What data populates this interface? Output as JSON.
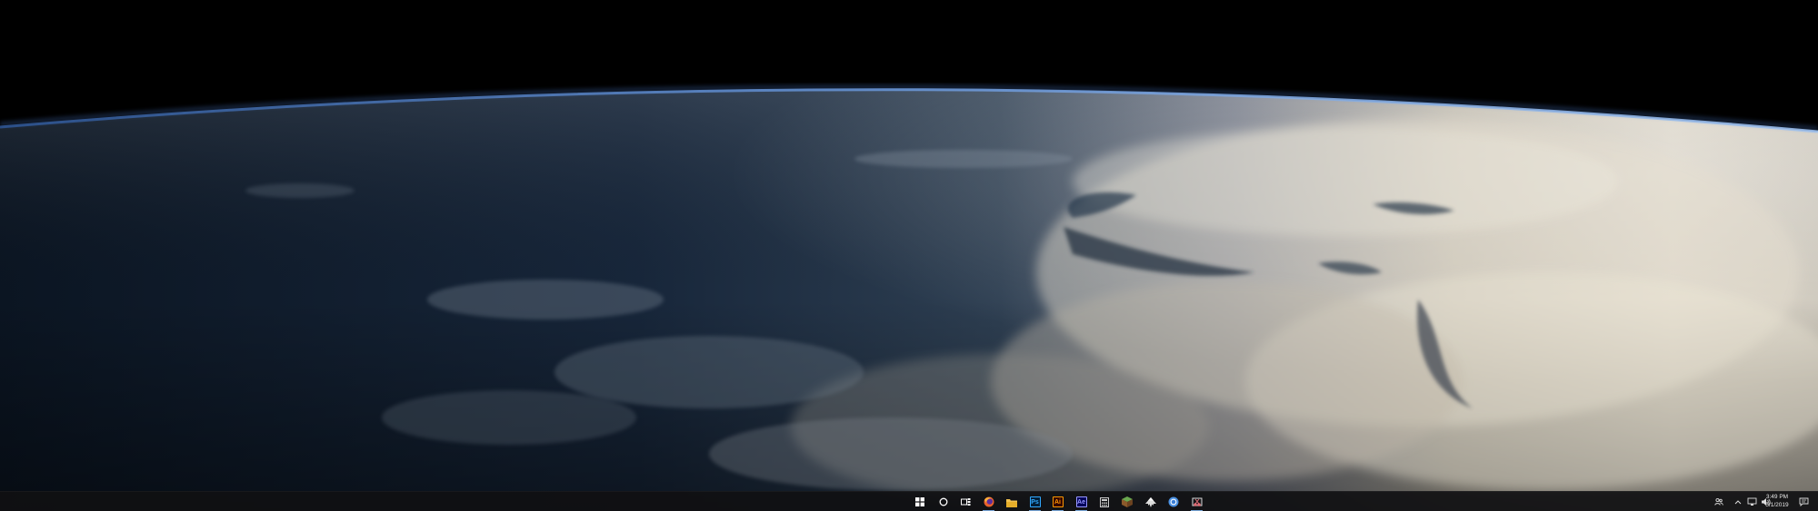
{
  "wallpaper": {
    "description_icon": "earth-from-orbit-wallpaper"
  },
  "taskbar": {
    "start_icon": "windows-logo-icon",
    "search_icon": "cortana-circle-icon",
    "taskview_icon": "task-view-icon",
    "apps": [
      {
        "name": "firefox",
        "icon": "firefox-icon",
        "color": "#e8612c"
      },
      {
        "name": "file-explorer",
        "icon": "folder-icon",
        "color": "#f2c14e"
      },
      {
        "name": "photoshop",
        "icon": "photoshop-icon",
        "color": "#31a8ff",
        "label": "Ps"
      },
      {
        "name": "illustrator",
        "icon": "illustrator-icon",
        "color": "#ff9a00",
        "label": "Ai"
      },
      {
        "name": "after-effects",
        "icon": "after-effects-icon",
        "color": "#9999ff",
        "label": "Ae"
      },
      {
        "name": "calculator",
        "icon": "calculator-icon",
        "color": "#cccccc"
      },
      {
        "name": "minecraft",
        "icon": "grass-block-icon",
        "color": "#6aa84f"
      },
      {
        "name": "inkscape",
        "icon": "inkscape-icon",
        "color": "#dddddd"
      },
      {
        "name": "chrome",
        "icon": "chrome-icon",
        "color": "#4a90e2"
      },
      {
        "name": "snipping-tool",
        "icon": "snipping-tool-icon",
        "color": "#e06c75"
      }
    ],
    "tray": {
      "people_icon": "people-icon",
      "chevron_icon": "chevron-up-icon",
      "network_icon": "network-icon",
      "volume_icon": "volume-icon",
      "notification_icon": "notification-icon"
    },
    "clock": {
      "time": "3:49 PM",
      "date": "5/1/2019"
    }
  }
}
